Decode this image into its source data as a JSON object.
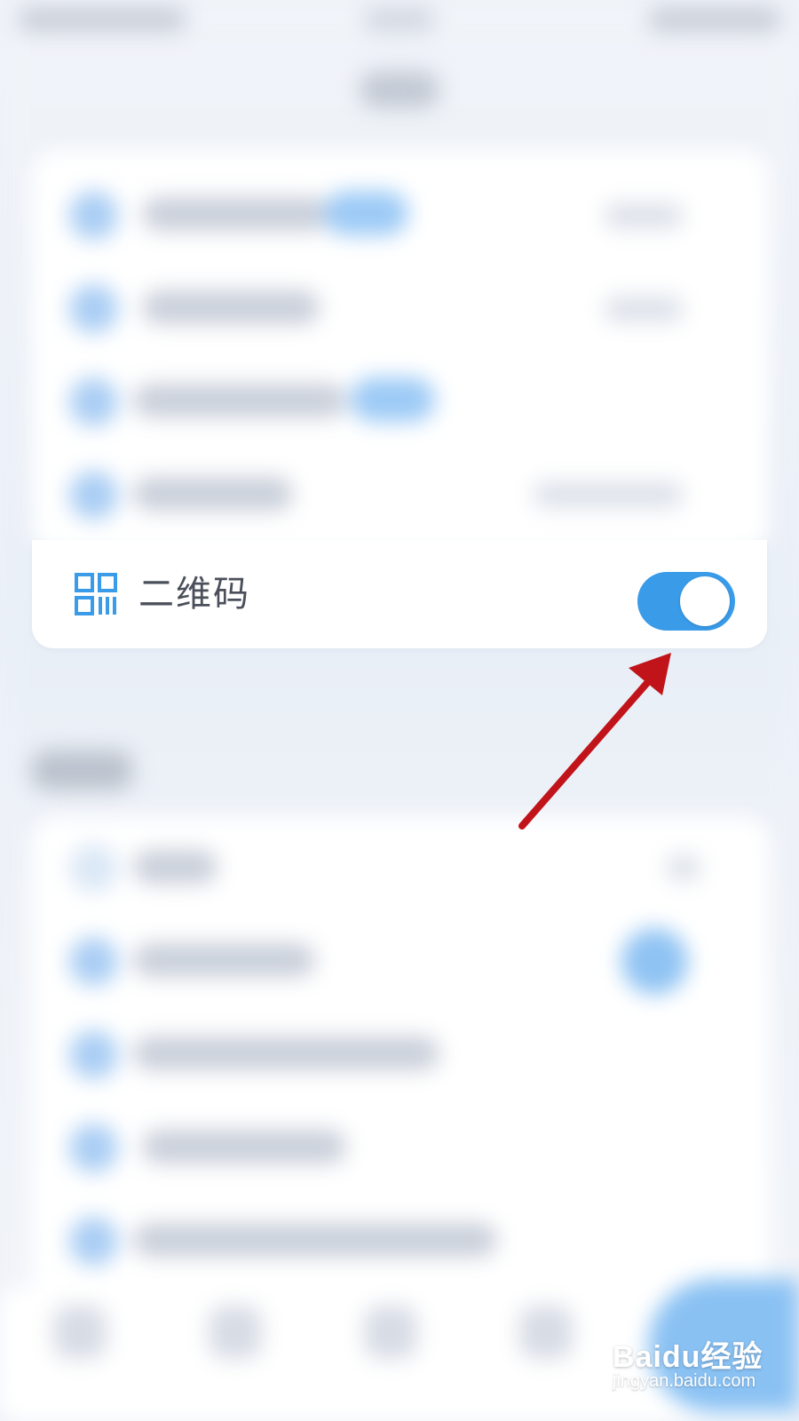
{
  "qr_setting": {
    "label": "二维码",
    "icon": "qr-code-icon",
    "enabled": true
  },
  "colors": {
    "accent": "#3a9be8",
    "annotation_arrow": "#c0141a"
  },
  "watermark": {
    "main": "Baidu经验",
    "sub": "jingyan.baidu.com"
  }
}
